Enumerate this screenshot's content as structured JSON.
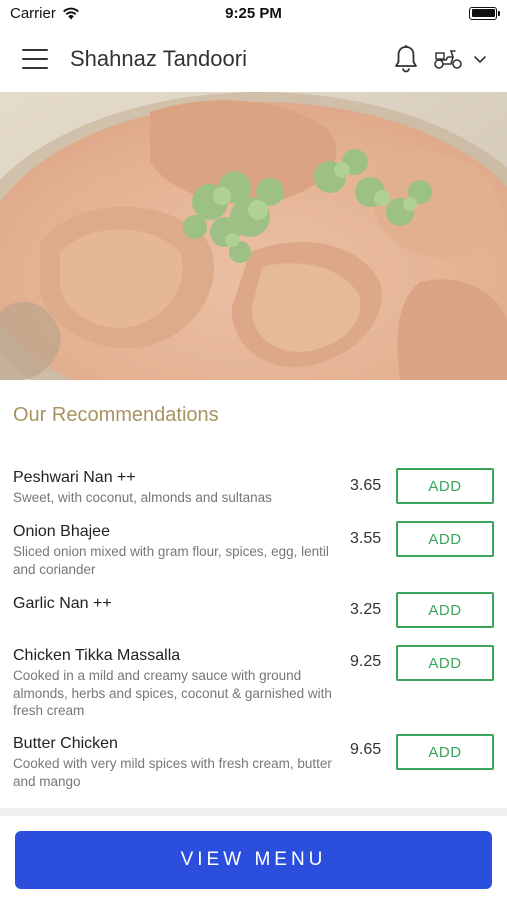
{
  "status_bar": {
    "carrier": "Carrier",
    "time": "9:25 PM"
  },
  "header": {
    "title": "Shahnaz Tandoori",
    "icons": [
      "menu-icon",
      "bell-icon",
      "scooter-icon",
      "chevron-down-icon"
    ]
  },
  "hero": {
    "image": "curry-dish-photo"
  },
  "recommendations": {
    "title": "Our Recommendations",
    "items": [
      {
        "name": "Peshwari Nan ++",
        "description": "Sweet, with coconut, almonds and sultanas",
        "price": "3.65",
        "button": "ADD"
      },
      {
        "name": "Onion Bhajee",
        "description": "Sliced onion mixed with gram flour, spices, egg, lentil and coriander",
        "price": "3.55",
        "button": "ADD"
      },
      {
        "name": "Garlic Nan ++",
        "description": "",
        "price": "3.25",
        "button": "ADD"
      },
      {
        "name": "Chicken Tikka Massalla",
        "description": "Cooked in a mild and creamy sauce with ground almonds, herbs and spices, coconut & garnished with fresh cream",
        "price": "9.25",
        "button": "ADD"
      },
      {
        "name": "Butter Chicken",
        "description": "Cooked with very mild spices with fresh cream, butter and mango",
        "price": "9.65",
        "button": "ADD"
      }
    ]
  },
  "footer": {
    "button": "VIEW MENU"
  },
  "colors": {
    "accent_gold": "#a89463",
    "add_green": "#3aa55a",
    "primary_blue": "#2b4fdc"
  }
}
